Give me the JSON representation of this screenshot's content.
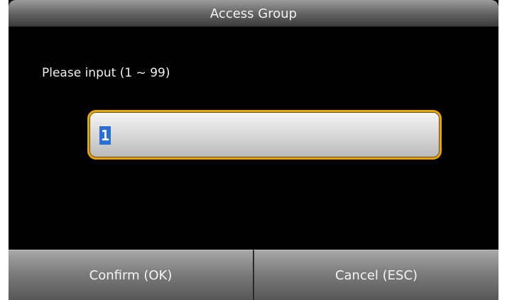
{
  "dialog": {
    "title": "Access Group",
    "prompt": "Please input (1 ~ 99)",
    "input": {
      "value": "1"
    },
    "buttons": {
      "confirm": "Confirm (OK)",
      "cancel": "Cancel (ESC)"
    }
  },
  "colors": {
    "background": "#000000",
    "input_border": "#e6a400",
    "selection": "#2a6fd6",
    "text": "#f0f0f0"
  }
}
